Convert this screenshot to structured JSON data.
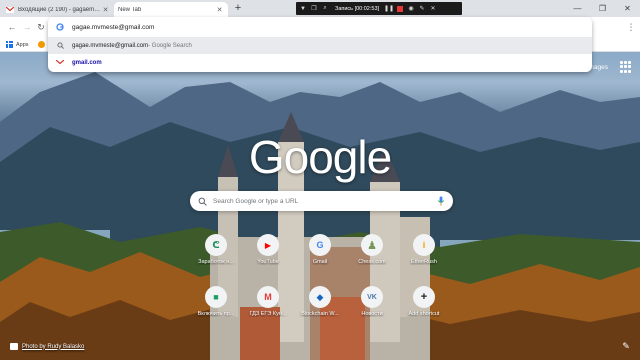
{
  "tabs": [
    {
      "label": "Входящие (2 190) - gagaemimve",
      "active": false,
      "icon": "gmail-icon"
    },
    {
      "label": "New Tab",
      "active": true,
      "icon": "none"
    }
  ],
  "recorder": {
    "label": "Запись [00:02:53]"
  },
  "omnibox": {
    "value": "gagae.mvmeste@gmail.com",
    "suggestions": [
      {
        "main": "gagae.mvmeste@gmail.com",
        "sub": " - Google Search",
        "icon": "search-icon"
      },
      {
        "main": "gmail.com",
        "sub": "",
        "icon": "gmail-icon"
      }
    ]
  },
  "bookmarks": {
    "apps_label": "Apps"
  },
  "ntp": {
    "images_link": "Images",
    "logo": "Google",
    "search_placeholder": "Search Google or type a URL",
    "shortcuts": [
      {
        "label": "Заработок н...",
        "glyph": "ᕦ",
        "color": "#1e8e5a"
      },
      {
        "label": "YouTube",
        "glyph": "▶",
        "color": "#ff0000"
      },
      {
        "label": "Gmail",
        "glyph": "G",
        "color": "#4285f4"
      },
      {
        "label": "Chess.com",
        "glyph": "♟",
        "color": "#769656"
      },
      {
        "label": "EtherRush",
        "glyph": "i",
        "color": "#f59f00"
      },
      {
        "label": "Включить пр...",
        "glyph": "■",
        "color": "#1e9e64"
      },
      {
        "label": "ГДЗ ЕГЭ Кун...",
        "glyph": "М",
        "color": "#e53935"
      },
      {
        "label": "Blockchain W...",
        "glyph": "◆",
        "color": "#1565c0"
      },
      {
        "label": "Новости",
        "glyph": "VK",
        "color": "#4a76a8"
      },
      {
        "label": "Add shortcut",
        "glyph": "+",
        "color": "#202124"
      }
    ],
    "photo_credit": "Photo by Rudy Balasko"
  },
  "colors": {
    "accent": "#1a73e8",
    "tab_bar": "#dee1e6"
  }
}
